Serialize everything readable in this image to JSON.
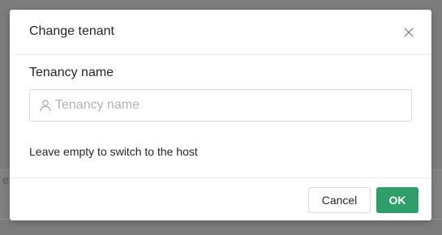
{
  "dialog": {
    "title": "Change tenant",
    "close_icon": "close-icon"
  },
  "form": {
    "field_label": "Tenancy name",
    "input_placeholder": "Tenancy name",
    "input_value": "",
    "input_icon": "user-icon",
    "hint": "Leave empty to switch to the host"
  },
  "footer": {
    "cancel_label": "Cancel",
    "ok_label": "OK"
  },
  "colors": {
    "primary": "#2e9e6a",
    "overlay": "#7d7d7d"
  }
}
